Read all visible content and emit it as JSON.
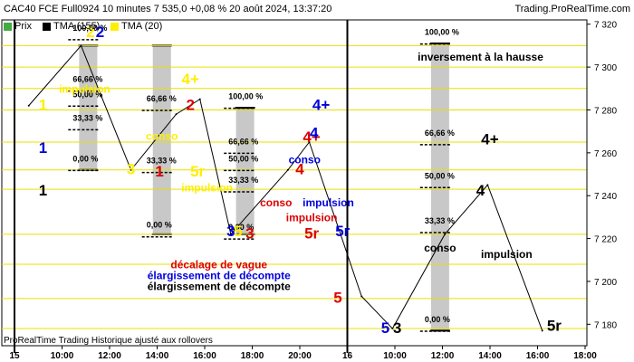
{
  "header": {
    "title": "CAC40 FCE Full0924 10 minutes 7 535,0 +0,08 % 20 août 2024, 13:37:20",
    "brand": "Trading.ProRealTime.com"
  },
  "legend": [
    {
      "label": "Prix",
      "color": "#44aa44"
    },
    {
      "label": "TMA (155)",
      "color": "#000000"
    },
    {
      "label": "TMA (20)",
      "color": "#ffee00"
    }
  ],
  "footer_note": "ProRealTime Trading Historique ajusté aux rollovers",
  "chart_data": {
    "type": "line",
    "ylim": [
      7170,
      7322
    ],
    "y_ticks": [
      7180,
      7200,
      7220,
      7240,
      7260,
      7280,
      7300,
      7320
    ],
    "y_tick_labels": [
      "7 180",
      "7 200",
      "7 220",
      "7 240",
      "7 260",
      "7 280",
      "7 300",
      "7 320"
    ],
    "x_ticks": [
      {
        "t": 0,
        "label": "15"
      },
      {
        "t": 2,
        "label": "10:00"
      },
      {
        "t": 4,
        "label": "12:00"
      },
      {
        "t": 6,
        "label": "14:00"
      },
      {
        "t": 8,
        "label": "16:00"
      },
      {
        "t": 10,
        "label": "18:00"
      },
      {
        "t": 12,
        "label": "20:00"
      },
      {
        "t": 14,
        "label": "16"
      },
      {
        "t": 16,
        "label": "10:00"
      },
      {
        "t": 18,
        "label": "12:00"
      },
      {
        "t": 20,
        "label": "14:00"
      },
      {
        "t": 22,
        "label": "16:00"
      },
      {
        "t": 24,
        "label": "18:00"
      }
    ],
    "day_separators": [
      0,
      14
    ],
    "horizontal_levels": [
      7310,
      7300,
      7290,
      7280,
      7265,
      7252,
      7243,
      7222,
      7208,
      7192,
      7178
    ],
    "series": [
      {
        "color": "#000000",
        "points": [
          [
            0.6,
            7282
          ],
          [
            2.8,
            7310
          ],
          [
            4.9,
            7252
          ],
          [
            6.8,
            7278
          ],
          [
            7.8,
            7285
          ],
          [
            9.1,
            7222
          ],
          [
            11.5,
            7252
          ],
          [
            12.4,
            7265
          ],
          [
            14.6,
            7193
          ],
          [
            15.9,
            7178
          ],
          [
            18.1,
            7222
          ],
          [
            19.9,
            7245
          ],
          [
            22.2,
            7177
          ]
        ]
      }
    ],
    "bars": [
      {
        "t": 3.1,
        "low": 7252,
        "high": 7310
      },
      {
        "t": 6.2,
        "low": 7222,
        "high": 7310
      },
      {
        "t": 9.7,
        "low": 7222,
        "high": 7281
      },
      {
        "t": 17.9,
        "low": 7177,
        "high": 7311
      }
    ],
    "bar_labels": [
      {
        "t": 2.45,
        "y": 7317,
        "text": "100,00 %"
      },
      {
        "t": 2.45,
        "y": 7293,
        "text": "66,66 %"
      },
      {
        "t": 2.45,
        "y": 7286,
        "text": "50,00 %"
      },
      {
        "t": 2.45,
        "y": 7275,
        "text": "33,33 %"
      },
      {
        "t": 2.45,
        "y": 7256,
        "text": "0,00 %"
      },
      {
        "t": 5.55,
        "y": 7284,
        "text": "66,66 %"
      },
      {
        "t": 5.55,
        "y": 7255,
        "text": "33,33 %"
      },
      {
        "t": 5.55,
        "y": 7225,
        "text": "0,00 %"
      },
      {
        "t": 9.0,
        "y": 7285,
        "text": "100,00 %"
      },
      {
        "t": 9.0,
        "y": 7264,
        "text": "66,66 %"
      },
      {
        "t": 9.0,
        "y": 7256,
        "text": "50,00 %"
      },
      {
        "t": 9.0,
        "y": 7246,
        "text": "33,33 %"
      },
      {
        "t": 9.0,
        "y": 7224,
        "text": "0,00 %"
      },
      {
        "t": 17.25,
        "y": 7315,
        "text": "100,00 %"
      },
      {
        "t": 17.25,
        "y": 7268,
        "text": "66,66 %"
      },
      {
        "t": 17.25,
        "y": 7248,
        "text": "50,00 %"
      },
      {
        "t": 17.25,
        "y": 7227,
        "text": "33,33 %"
      },
      {
        "t": 17.25,
        "y": 7181,
        "text": "0,00 %"
      }
    ],
    "annotations": [
      {
        "t": 1.2,
        "y": 7280,
        "text": "1",
        "color": "#ffee00",
        "size": 17
      },
      {
        "t": 1.2,
        "y": 7260,
        "text": "1",
        "color": "#0000dd",
        "size": 17
      },
      {
        "t": 1.2,
        "y": 7240,
        "text": "1",
        "color": "#000000",
        "size": 17
      },
      {
        "t": 3.2,
        "y": 7314,
        "text": "2",
        "color": "#ffee00",
        "size": 17
      },
      {
        "t": 3.6,
        "y": 7314,
        "text": "2",
        "color": "#0000dd",
        "size": 17
      },
      {
        "t": 2.95,
        "y": 7288,
        "text": "impulsion",
        "color": "#ffee00",
        "size": 12
      },
      {
        "t": 4.9,
        "y": 7250,
        "text": "3",
        "color": "#ffee00",
        "size": 17
      },
      {
        "t": 6.1,
        "y": 7249,
        "text": "1",
        "color": "#dd0000",
        "size": 17
      },
      {
        "t": 6.2,
        "y": 7266,
        "text": "conso",
        "color": "#ffee00",
        "size": 12
      },
      {
        "t": 7.4,
        "y": 7292,
        "text": "4+",
        "color": "#ffee00",
        "size": 17
      },
      {
        "t": 7.4,
        "y": 7280,
        "text": "2",
        "color": "#dd0000",
        "size": 17
      },
      {
        "t": 7.7,
        "y": 7249,
        "text": "5r",
        "color": "#ffee00",
        "size": 17
      },
      {
        "t": 8.1,
        "y": 7242,
        "text": "impulsion",
        "color": "#ffee00",
        "size": 12
      },
      {
        "t": 8.6,
        "y": 7206,
        "text": "décalage de vague",
        "color": "#dd0000",
        "size": 12
      },
      {
        "t": 8.6,
        "y": 7201,
        "text": "élargissement de décompte",
        "color": "#0000dd",
        "size": 12
      },
      {
        "t": 8.6,
        "y": 7196,
        "text": "élargissement de décompte",
        "color": "#000000",
        "size": 12
      },
      {
        "t": 9.1,
        "y": 7221,
        "text": "3",
        "color": "#0000dd",
        "size": 17
      },
      {
        "t": 9.4,
        "y": 7221,
        "text": "5",
        "color": "#ffee00",
        "size": 17
      },
      {
        "t": 9.9,
        "y": 7220,
        "text": "3",
        "color": "#dd0000",
        "size": 17
      },
      {
        "t": 11.0,
        "y": 7235,
        "text": "conso",
        "color": "#dd0000",
        "size": 12
      },
      {
        "t": 12.5,
        "y": 7228,
        "text": "impulsion",
        "color": "#dd0000",
        "size": 12
      },
      {
        "t": 13.2,
        "y": 7235,
        "text": "impulsion",
        "color": "#0000dd",
        "size": 12
      },
      {
        "t": 12.2,
        "y": 7255,
        "text": "conso",
        "color": "#0000dd",
        "size": 12
      },
      {
        "t": 12.0,
        "y": 7250,
        "text": "4",
        "color": "#dd0000",
        "size": 17
      },
      {
        "t": 12.5,
        "y": 7265,
        "text": "4+",
        "color": "#dd0000",
        "size": 17
      },
      {
        "t": 12.6,
        "y": 7267,
        "text": "4",
        "color": "#0000dd",
        "size": 17
      },
      {
        "t": 12.9,
        "y": 7280,
        "text": "4+",
        "color": "#0000dd",
        "size": 17
      },
      {
        "t": 12.5,
        "y": 7220,
        "text": "5r",
        "color": "#dd0000",
        "size": 17
      },
      {
        "t": 13.8,
        "y": 7221,
        "text": "5r",
        "color": "#0000dd",
        "size": 17
      },
      {
        "t": 13.6,
        "y": 7190,
        "text": "5",
        "color": "#dd0000",
        "size": 17
      },
      {
        "t": 15.6,
        "y": 7176,
        "text": "5",
        "color": "#0000dd",
        "size": 17
      },
      {
        "t": 16.1,
        "y": 7176,
        "text": "3",
        "color": "#000000",
        "size": 17
      },
      {
        "t": 17.9,
        "y": 7214,
        "text": "conso",
        "color": "#000000",
        "size": 12
      },
      {
        "t": 20.7,
        "y": 7211,
        "text": "impulsion",
        "color": "#000000",
        "size": 12
      },
      {
        "t": 19.6,
        "y": 7303,
        "text": "inversement à la hausse",
        "color": "#000000",
        "size": 12
      },
      {
        "t": 20.0,
        "y": 7264,
        "text": "4+",
        "color": "#000000",
        "size": 17
      },
      {
        "t": 19.6,
        "y": 7240,
        "text": "4",
        "color": "#000000",
        "size": 17
      },
      {
        "t": 22.7,
        "y": 7177,
        "text": "5r",
        "color": "#000000",
        "size": 17
      }
    ]
  }
}
